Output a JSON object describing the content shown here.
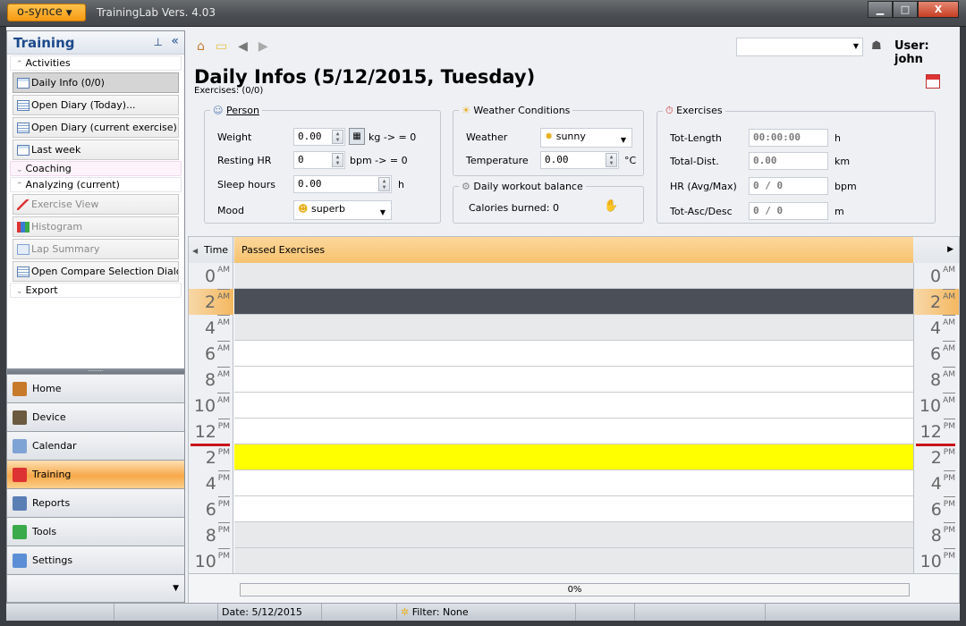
{
  "app": {
    "menu_label": "o-synce",
    "title": "TrainingLab Vers. 4.03"
  },
  "window_buttons": {
    "minimize": "▁",
    "maximize": "□",
    "close": "X"
  },
  "sidebar": {
    "title": "Training",
    "pin_icon": "pin-icon",
    "collapse_icon": "«",
    "groups": [
      {
        "label": "Activities",
        "expanded": true,
        "items": [
          {
            "label": "Daily Info (0/0)",
            "icon": "calendar-icon",
            "active": true
          },
          {
            "label": "Open Diary (Today)...",
            "icon": "diary-icon"
          },
          {
            "label": "Open Diary (current exercise)...",
            "icon": "diary-exercise-icon"
          },
          {
            "label": "Last week",
            "icon": "week-icon"
          }
        ]
      },
      {
        "label": "Coaching",
        "expanded": false,
        "items": []
      },
      {
        "label": "Analyzing (current)",
        "expanded": true,
        "items": [
          {
            "label": "Exercise View",
            "icon": "exercise-chart-icon",
            "disabled": true
          },
          {
            "label": "Histogram",
            "icon": "histogram-icon",
            "disabled": true
          },
          {
            "label": "Lap Summary",
            "icon": "lap-summary-icon",
            "disabled": true
          },
          {
            "label": "Open Compare Selection Dialo...",
            "icon": "compare-icon"
          }
        ]
      },
      {
        "label": "Export",
        "expanded": false,
        "items": []
      }
    ],
    "nav": [
      {
        "label": "Home",
        "icon": "home-icon",
        "color": "#c77a2a"
      },
      {
        "label": "Device",
        "icon": "device-icon",
        "color": "#6b5a3f"
      },
      {
        "label": "Calendar",
        "icon": "calendar-icon",
        "color": "#7fa3d4"
      },
      {
        "label": "Training",
        "icon": "training-icon",
        "color": "#d33",
        "active": true
      },
      {
        "label": "Reports",
        "icon": "reports-icon",
        "color": "#5a7fb5"
      },
      {
        "label": "Tools",
        "icon": "tools-icon",
        "color": "#3aaa4a"
      },
      {
        "label": "Settings",
        "icon": "settings-icon",
        "color": "#5a8fd5"
      }
    ]
  },
  "toolbar": {
    "user_combo_value": "",
    "user_label": "User: john"
  },
  "page": {
    "title": "Daily Infos (5/12/2015, Tuesday)",
    "subtitle": "Exercises: (0/0)"
  },
  "person": {
    "legend": "Person",
    "weight": {
      "label": "Weight",
      "value": "0.00",
      "unit": "kg  -> = 0"
    },
    "resting_hr": {
      "label": "Resting HR",
      "value": "0",
      "unit": "bpm  -> = 0"
    },
    "sleep": {
      "label": "Sleep hours",
      "value": "0.00",
      "unit": "h"
    },
    "mood": {
      "label": "Mood",
      "value": "superb"
    }
  },
  "weather": {
    "legend": "Weather Conditions",
    "weather": {
      "label": "Weather",
      "value": "sunny"
    },
    "temperature": {
      "label": "Temperature",
      "value": "0.00",
      "unit": "°C"
    }
  },
  "balance": {
    "legend": "Daily workout balance",
    "calories": "Calories burned: 0"
  },
  "exercises": {
    "legend": "Exercises",
    "tot_length": {
      "label": "Tot-Length",
      "value": "00:00:00",
      "unit": "h"
    },
    "total_dist": {
      "label": "Total-Dist.",
      "value": "0.00",
      "unit": "km"
    },
    "hr": {
      "label": "HR (Avg/Max)",
      "value": "0 / 0",
      "unit": "bpm"
    },
    "asc_desc": {
      "label": "Tot-Asc/Desc",
      "value": "0 / 0",
      "unit": "m"
    }
  },
  "schedule": {
    "time_header": "Time",
    "column_header": "Passed Exercises",
    "slots": [
      {
        "hour": "0",
        "ampm": "AM",
        "bg": "#e8e9eb"
      },
      {
        "hour": "2",
        "ampm": "AM",
        "bg": "#4b5058",
        "highlight": true
      },
      {
        "hour": "4",
        "ampm": "AM",
        "bg": "#e8e9eb"
      },
      {
        "hour": "6",
        "ampm": "AM",
        "bg": "#ffffff"
      },
      {
        "hour": "8",
        "ampm": "AM",
        "bg": "#ffffff"
      },
      {
        "hour": "10",
        "ampm": "AM",
        "bg": "#ffffff"
      },
      {
        "hour": "12",
        "ampm": "PM",
        "bg": "#ffffff"
      },
      {
        "hour": "2",
        "ampm": "PM",
        "bg": "#ffff00"
      },
      {
        "hour": "4",
        "ampm": "PM",
        "bg": "#ffffff"
      },
      {
        "hour": "6",
        "ampm": "PM",
        "bg": "#ffffff"
      },
      {
        "hour": "8",
        "ampm": "PM",
        "bg": "#e8e9eb"
      },
      {
        "hour": "10",
        "ampm": "PM",
        "bg": "#e8e9eb"
      }
    ],
    "current_time_slot": 7,
    "progress_text": "0%",
    "progress": 0
  },
  "statusbar": {
    "date": "Date: 5/12/2015",
    "filter": "Filter: None"
  }
}
